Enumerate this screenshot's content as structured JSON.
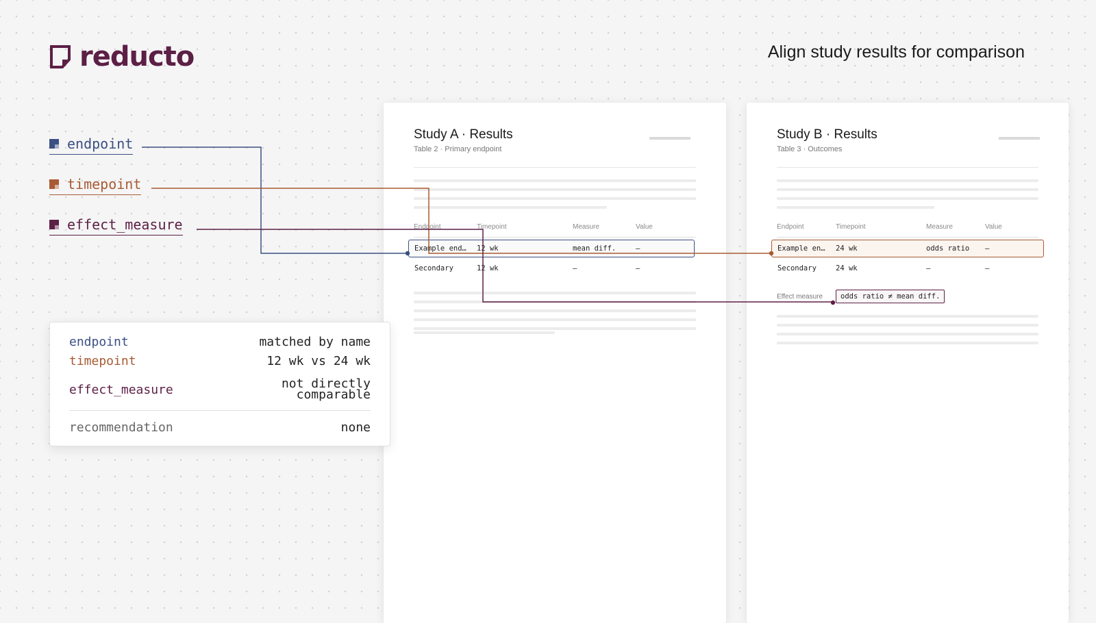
{
  "brand": {
    "name": "reducto",
    "icon": "document-corner-icon",
    "color": "#5c1f45"
  },
  "headline": "Align study results for comparison",
  "fields": [
    {
      "id": "endpoint",
      "label": "endpoint",
      "color": "#3b4f82"
    },
    {
      "id": "timepoint",
      "label": "timepoint",
      "color": "#a85a33"
    },
    {
      "id": "effect_measure",
      "label": "effect_measure",
      "color": "#5c1f45"
    }
  ],
  "study_a": {
    "title": "Study A · Results",
    "subtitle": "Table 2 · Primary endpoint",
    "headers": [
      "Endpoint",
      "Timepoint",
      "Measure",
      "Value"
    ],
    "rows": [
      [
        "Example end…",
        "12 wk",
        "mean diff.",
        "—"
      ],
      [
        "Secondary",
        "12 wk",
        "—",
        "—"
      ]
    ]
  },
  "study_b": {
    "title": "Study B · Results",
    "subtitle": "Table 3 · Outcomes",
    "headers": [
      "Endpoint",
      "Timepoint",
      "Measure",
      "Value"
    ],
    "rows": [
      [
        "Example en…",
        "24 wk",
        "odds ratio",
        "—"
      ],
      [
        "Secondary",
        "24 wk",
        "—",
        "—"
      ]
    ],
    "effect_label": "Effect measure",
    "effect_note": "odds ratio ≠ mean diff."
  },
  "summary": {
    "rows": [
      {
        "key": "endpoint",
        "value": "matched by name"
      },
      {
        "key": "timepoint",
        "value": "12 wk vs 24 wk"
      },
      {
        "key": "effect_measure",
        "value_line1": "not directly",
        "value_line2": "comparable"
      }
    ],
    "recommendation": {
      "key": "recommendation",
      "value": "none"
    }
  }
}
